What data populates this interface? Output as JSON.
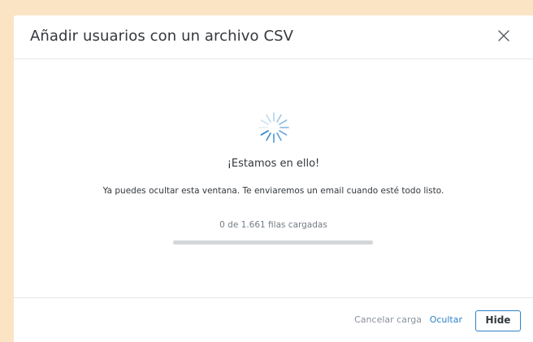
{
  "dialog": {
    "title": "Añadir usuarios con un archivo CSV",
    "close_icon": "close-icon"
  },
  "status": {
    "spinner_icon": "loading-spinner-icon",
    "heading": "¡Estamos en ello!",
    "message": "Ya puedes ocultar esta ventana. Te enviaremos un email cuando esté todo listo.",
    "progress_text": "0 de 1.661 filas cargadas",
    "progress_fraction": 0
  },
  "footer": {
    "cancel_label": "Cancelar carga",
    "hide_link_label": "Ocultar",
    "hide_button_label": "Hide"
  },
  "colors": {
    "backdrop": "#fbe4c4",
    "accent": "#2c83c9",
    "text": "#33383d",
    "muted": "#737b84",
    "progress_track": "#d4d7da"
  }
}
